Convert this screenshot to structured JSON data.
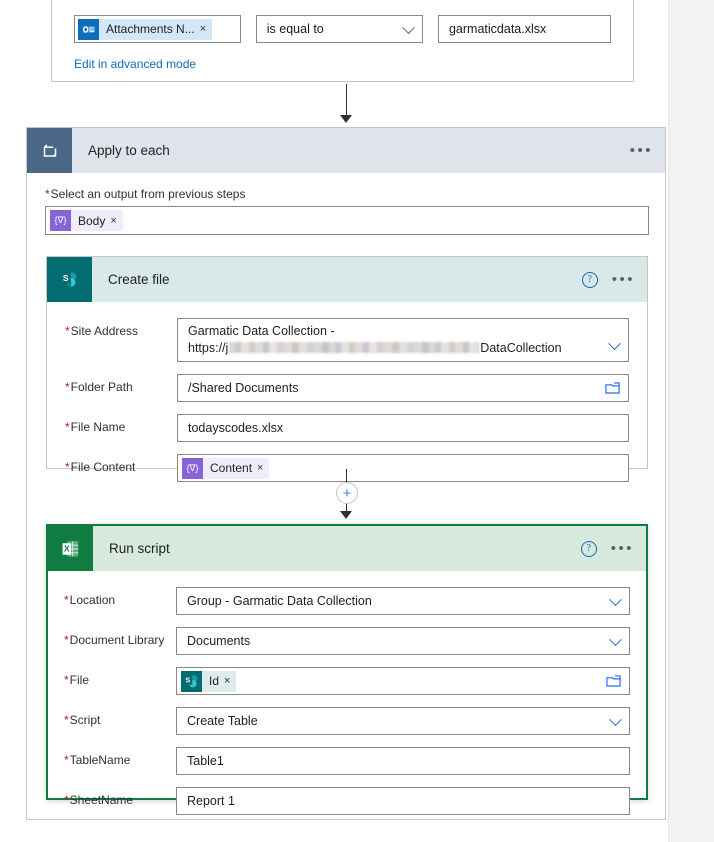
{
  "condition": {
    "token": {
      "label": "Attachments N...",
      "icon": "outlook-icon",
      "remove": "×"
    },
    "operator": "is equal to",
    "value": "garmaticdata.xlsx",
    "advanced_link": "Edit in advanced mode"
  },
  "apply_to_each": {
    "title": "Apply to each",
    "icon": "loop-icon",
    "menu": "•••",
    "input_label": "Select an output from previous steps",
    "required_mark": "*",
    "token": {
      "label": "Body",
      "icon": "expression-icon",
      "glyph": "{∇}",
      "remove": "×"
    }
  },
  "create_file": {
    "title": "Create file",
    "icon": "sharepoint-icon",
    "help": "?",
    "menu": "•••",
    "fields": [
      {
        "label": "Site Address",
        "required": true,
        "type": "dropdown-multiline",
        "value_line1": "Garmatic Data Collection -",
        "value_prefix": "https://j",
        "value_redacted": true,
        "value_suffix": "DataCollection"
      },
      {
        "label": "Folder Path",
        "required": true,
        "type": "text-folder",
        "value": "/Shared Documents"
      },
      {
        "label": "File Name",
        "required": true,
        "type": "text",
        "value": "todayscodes.xlsx"
      },
      {
        "label": "File Content",
        "required": true,
        "type": "token",
        "token": {
          "label": "Content",
          "icon": "expression-icon",
          "glyph": "{∇}",
          "remove": "×"
        }
      }
    ]
  },
  "run_script": {
    "title": "Run script",
    "icon": "excel-icon",
    "help": "?",
    "menu": "•••",
    "selected": true,
    "accent_color": "#107c41",
    "fields": [
      {
        "label": "Location",
        "required": true,
        "type": "dropdown",
        "value": "Group - Garmatic Data Collection"
      },
      {
        "label": "Document Library",
        "required": true,
        "type": "dropdown",
        "value": "Documents"
      },
      {
        "label": "File",
        "required": true,
        "type": "token-folder",
        "token": {
          "label": "Id",
          "icon": "sharepoint-icon",
          "remove": "×"
        }
      },
      {
        "label": "Script",
        "required": true,
        "type": "dropdown",
        "value": "Create Table"
      },
      {
        "label": "TableName",
        "required": true,
        "type": "text",
        "value": "Table1"
      },
      {
        "label": "SheetName",
        "required": true,
        "type": "text",
        "value": "Report 1"
      }
    ]
  },
  "connectors": {
    "add_step": "+"
  },
  "colors": {
    "loop_header": "#dfe3eb",
    "loop_icon_bg": "#4a6785",
    "sharepoint_header": "#d9e8e8",
    "sharepoint_icon_bg": "#036c70",
    "excel_header": "#d7e8dd",
    "excel_icon_bg": "#107c41",
    "link": "#0f6cbd",
    "required": "#a4262c"
  }
}
